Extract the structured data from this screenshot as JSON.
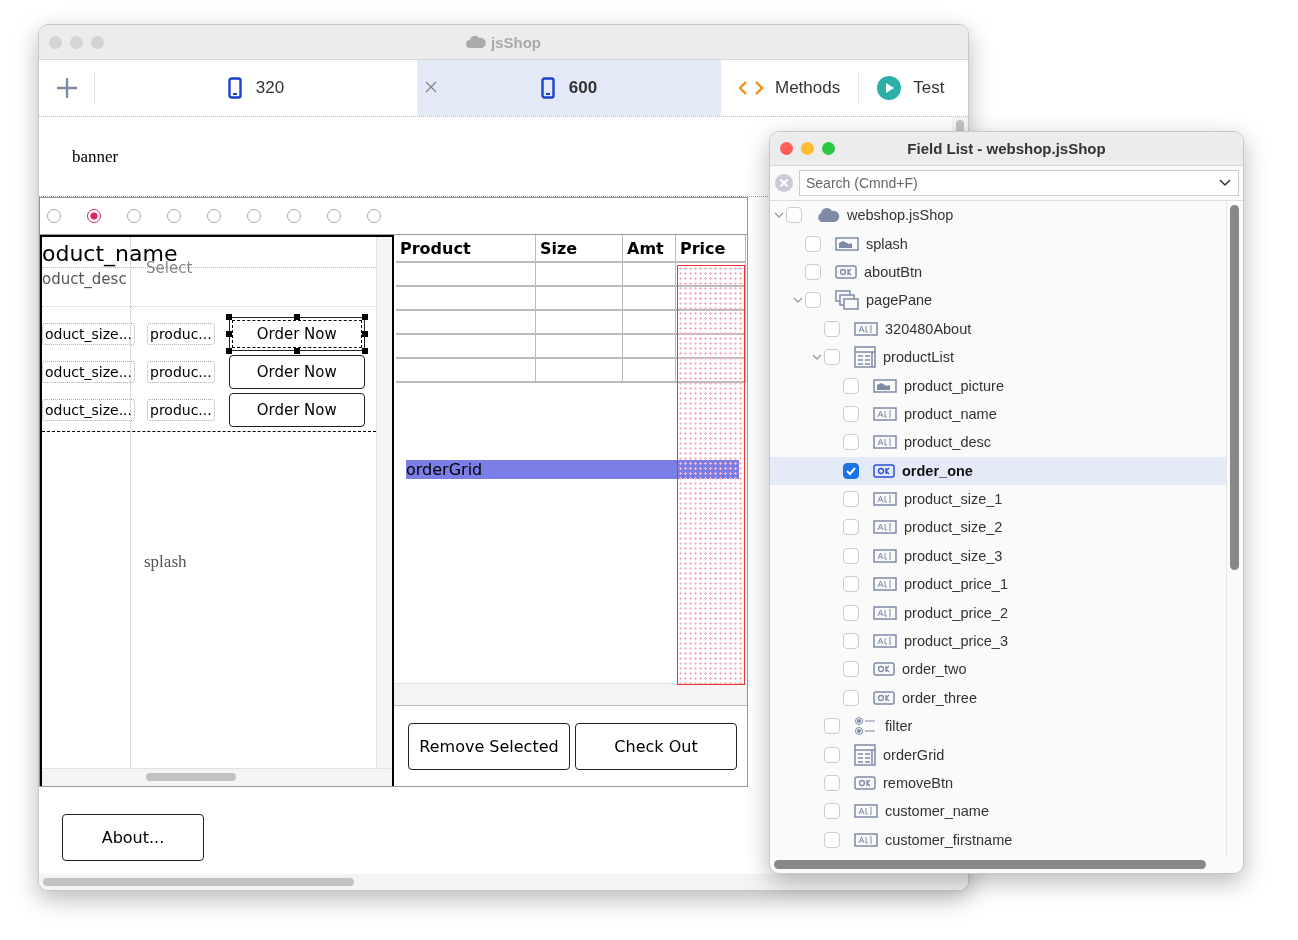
{
  "main_window": {
    "title": "jsShop"
  },
  "toolbar": {
    "tabs": [
      {
        "label": "320",
        "selected": false
      },
      {
        "label": "600",
        "selected": true
      }
    ],
    "methods_label": "Methods",
    "test_label": "Test"
  },
  "canvas": {
    "banner_label": "banner",
    "filter": [
      {
        "selected": false
      },
      {
        "selected": true
      },
      {
        "selected": false
      },
      {
        "selected": false
      },
      {
        "selected": false
      },
      {
        "selected": false
      },
      {
        "selected": false
      },
      {
        "selected": false
      },
      {
        "selected": false
      }
    ],
    "product_list": {
      "name_label": "oduct_name",
      "select_label": "Select",
      "desc_label": "oduct_desc",
      "rows": [
        {
          "size": "oduct_size...",
          "price": "produc...",
          "button": "Order Now",
          "selected": true
        },
        {
          "size": "oduct_size...",
          "price": "produc...",
          "button": "Order Now",
          "selected": false
        },
        {
          "size": "oduct_size...",
          "price": "produc...",
          "button": "Order Now",
          "selected": false
        }
      ],
      "splash_label": "splash"
    },
    "order_grid": {
      "columns": [
        "Product",
        "Size",
        "Amt",
        "Price"
      ],
      "label": "orderGrid",
      "buttons": [
        "Remove Selected",
        "Check Out"
      ]
    },
    "about_button": "About..."
  },
  "field_list": {
    "title": "Field List - webshop.jsShop",
    "search": {
      "placeholder": "Search (Cmnd+F)"
    },
    "tree": [
      {
        "label": "webshop.jsShop",
        "kind": "cloud",
        "checked": false,
        "selected": false,
        "expanded": true,
        "children": [
          {
            "label": "splash",
            "kind": "image",
            "checked": false,
            "selected": false
          },
          {
            "label": "aboutBtn",
            "kind": "button",
            "checked": false,
            "selected": false
          },
          {
            "label": "pagePane",
            "kind": "pane",
            "checked": false,
            "selected": false,
            "expanded": true,
            "children": [
              {
                "label": "320480About",
                "kind": "text",
                "checked": false,
                "selected": false
              },
              {
                "label": "productList",
                "kind": "list",
                "checked": false,
                "selected": false,
                "expanded": true,
                "children": [
                  {
                    "label": "product_picture",
                    "kind": "image",
                    "checked": false,
                    "selected": false
                  },
                  {
                    "label": "product_name",
                    "kind": "text",
                    "checked": false,
                    "selected": false
                  },
                  {
                    "label": "product_desc",
                    "kind": "text",
                    "checked": false,
                    "selected": false
                  },
                  {
                    "label": "order_one",
                    "kind": "button",
                    "checked": true,
                    "selected": true
                  },
                  {
                    "label": "product_size_1",
                    "kind": "text",
                    "checked": false,
                    "selected": false
                  },
                  {
                    "label": "product_size_2",
                    "kind": "text",
                    "checked": false,
                    "selected": false
                  },
                  {
                    "label": "product_size_3",
                    "kind": "text",
                    "checked": false,
                    "selected": false
                  },
                  {
                    "label": "product_price_1",
                    "kind": "text",
                    "checked": false,
                    "selected": false
                  },
                  {
                    "label": "product_price_2",
                    "kind": "text",
                    "checked": false,
                    "selected": false
                  },
                  {
                    "label": "product_price_3",
                    "kind": "text",
                    "checked": false,
                    "selected": false
                  },
                  {
                    "label": "order_two",
                    "kind": "button",
                    "checked": false,
                    "selected": false
                  },
                  {
                    "label": "order_three",
                    "kind": "button",
                    "checked": false,
                    "selected": false
                  }
                ]
              },
              {
                "label": "filter",
                "kind": "radio",
                "checked": false,
                "selected": false
              },
              {
                "label": "orderGrid",
                "kind": "list",
                "checked": false,
                "selected": false
              },
              {
                "label": "removeBtn",
                "kind": "button",
                "checked": false,
                "selected": false
              },
              {
                "label": "customer_name",
                "kind": "text",
                "checked": false,
                "selected": false
              },
              {
                "label": "customer_firstname",
                "kind": "text",
                "checked": false,
                "selected": false
              }
            ]
          }
        ]
      }
    ]
  }
}
